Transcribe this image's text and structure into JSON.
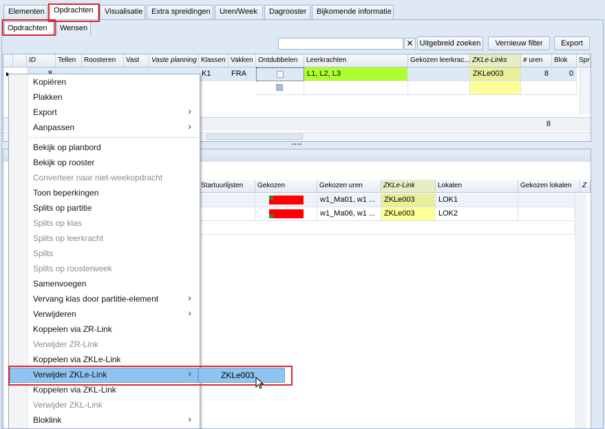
{
  "main_tabs": [
    "Elementen",
    "Opdrachten",
    "Visualisatie",
    "Extra spreidingen",
    "Uren/Week",
    "Dagrooster",
    "Bijkomende informatie"
  ],
  "sub_tabs": [
    "Opdrachten",
    "Wensen"
  ],
  "toolbar": {
    "clear_icon": "✕",
    "advanced_search": "Uitgebreid zoeken",
    "refresh_filter": "Vernieuw filter",
    "export": "Export"
  },
  "top_grid": {
    "columns": [
      "ID",
      "Tellen",
      "Roosteren",
      "Vast",
      "Vaste planning",
      "Klassen",
      "Vakken",
      "Ontdubbelen",
      "Leerkrachten",
      "Gekozen leerkrac...",
      "ZKLe-Links",
      "# uren",
      "Blok",
      "Spre"
    ],
    "row1": {
      "id": "8",
      "klassen": "K1",
      "vakken": "FRA",
      "leerkrachten": "L1, L2, L3",
      "zkle": "ZKLe003",
      "uren": "8",
      "blok": "0"
    },
    "footer_total": "8"
  },
  "bottom_grid": {
    "columns": [
      "Startuurlijsten",
      "Gekozen",
      "Gekozen uren",
      "ZKLe-Link",
      "Lokalen",
      "Gekozen lokalen",
      "Z"
    ],
    "rows": [
      {
        "gekozen_uren": "w1_Ma01, w1 ...",
        "zkle": "ZKLe003",
        "lokaal": "LOK1"
      },
      {
        "gekozen_uren": "w1_Ma06, w1 ...",
        "zkle": "ZKLe003",
        "lokaal": "LOK2"
      }
    ]
  },
  "context_menu": {
    "items": [
      {
        "label": "Kopiëren",
        "disabled": false,
        "submenu": false
      },
      {
        "label": "Plakken",
        "disabled": false,
        "submenu": false
      },
      {
        "label": "Export",
        "disabled": false,
        "submenu": true
      },
      {
        "label": "Aanpassen",
        "disabled": false,
        "submenu": true
      },
      {
        "label": "Bekijk op planbord",
        "disabled": false,
        "submenu": false
      },
      {
        "label": "Bekijk op rooster",
        "disabled": false,
        "submenu": false
      },
      {
        "label": "Converteer naar niet-weekopdracht",
        "disabled": true,
        "submenu": false
      },
      {
        "label": "Toon beperkingen",
        "disabled": false,
        "submenu": false
      },
      {
        "label": "Splits op partitie",
        "disabled": false,
        "submenu": false
      },
      {
        "label": "Splits op klas",
        "disabled": true,
        "submenu": false
      },
      {
        "label": "Splits op leerkracht",
        "disabled": true,
        "submenu": false
      },
      {
        "label": "Splits",
        "disabled": true,
        "submenu": false
      },
      {
        "label": "Splits op roosterweek",
        "disabled": true,
        "submenu": false
      },
      {
        "label": "Samenvoegen",
        "disabled": false,
        "submenu": false
      },
      {
        "label": "Vervang klas door partitie-element",
        "disabled": false,
        "submenu": true
      },
      {
        "label": "Verwijderen",
        "disabled": false,
        "submenu": true
      },
      {
        "label": "Koppelen via ZR-Link",
        "disabled": false,
        "submenu": false
      },
      {
        "label": "Verwijder ZR-Link",
        "disabled": true,
        "submenu": false
      },
      {
        "label": "Koppelen via ZKLe-Link",
        "disabled": false,
        "submenu": false
      },
      {
        "label": "Verwijder ZKLe-Link",
        "disabled": false,
        "submenu": true
      },
      {
        "label": "Koppelen via ZKL-Link",
        "disabled": false,
        "submenu": false
      },
      {
        "label": "Verwijder ZKL-Link",
        "disabled": true,
        "submenu": false
      },
      {
        "label": "Bloklink",
        "disabled": false,
        "submenu": true
      }
    ],
    "submenu_item": "ZKLe003"
  },
  "colors": {
    "accent_red": "#d9262e",
    "green_cell": "#adff2f",
    "yellow_cell": "#ffff99",
    "menu_highlight": "#8fc3f0",
    "gekozen_red": "#ff0000",
    "gekozen_green": "#2e8b2e"
  }
}
